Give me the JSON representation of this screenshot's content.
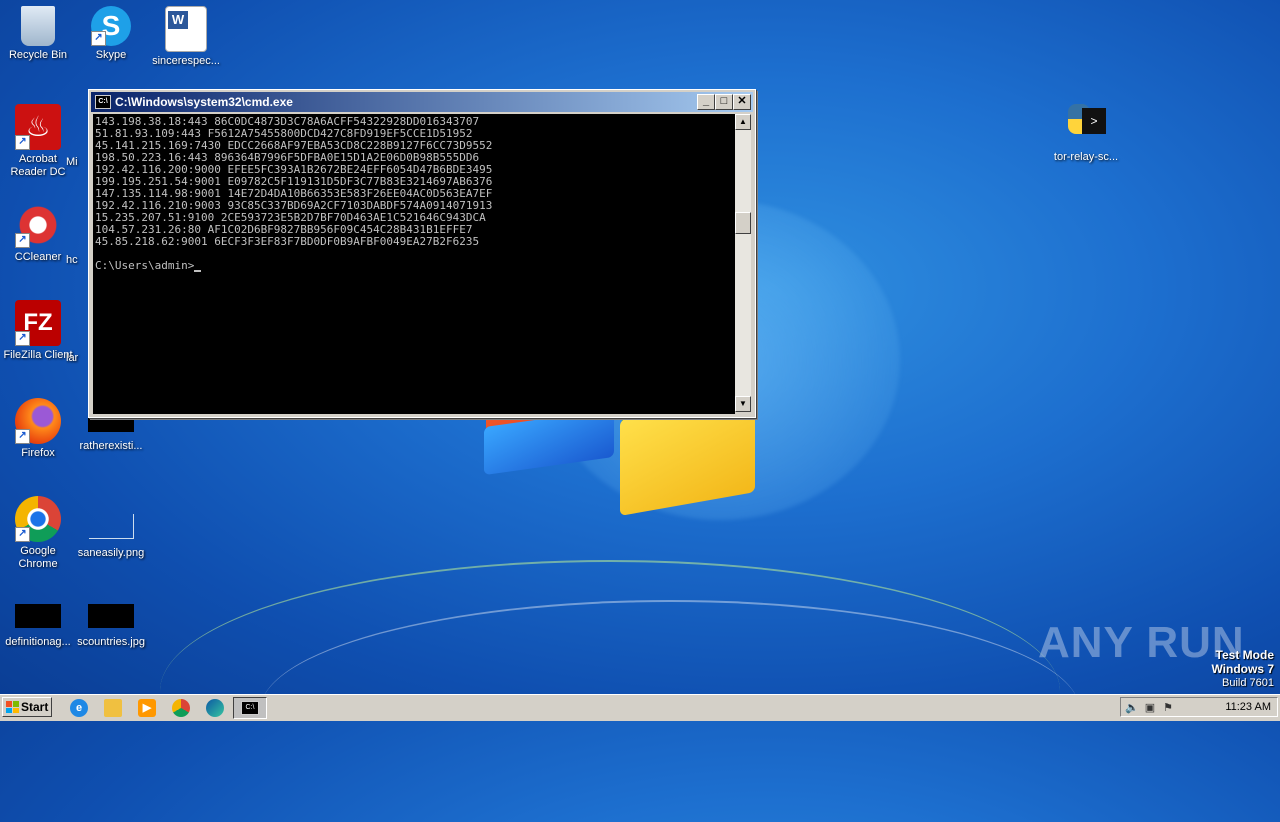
{
  "desktop": {
    "icons": [
      {
        "label": "Recycle Bin",
        "icon": "recycle-bin-icon"
      },
      {
        "label": "Skype",
        "icon": "skype-icon"
      },
      {
        "label": "sincerespec...",
        "icon": "word-document-icon"
      },
      {
        "label": "Acrobat Reader DC",
        "icon": "acrobat-icon"
      },
      {
        "label": "Mi",
        "icon": "partial-icon"
      },
      {
        "label": "CCleaner",
        "icon": "ccleaner-icon"
      },
      {
        "label": "hc",
        "icon": "partial-icon"
      },
      {
        "label": "FileZilla Client",
        "icon": "filezilla-icon"
      },
      {
        "label": "lar",
        "icon": "partial-icon"
      },
      {
        "label": "Firefox",
        "icon": "firefox-icon"
      },
      {
        "label": "ratherexisti...",
        "icon": "black-file-icon"
      },
      {
        "label": "Google Chrome",
        "icon": "chrome-icon"
      },
      {
        "label": "saneasily.png",
        "icon": "png-file-icon"
      },
      {
        "label": "definitionag...",
        "icon": "black-file-icon"
      },
      {
        "label": "scountries.jpg",
        "icon": "black-file-icon"
      },
      {
        "label": "tor-relay-sc...",
        "icon": "python-script-icon"
      }
    ]
  },
  "cmd_window": {
    "title": "C:\\Windows\\system32\\cmd.exe",
    "minimize": "_",
    "maximize": "□",
    "close": "✕",
    "lines": [
      "143.198.38.18:443 86C0DC4873D3C78A6ACFF54322928DD016343707",
      "51.81.93.109:443 F5612A75455800DCD427C8FD919EF5CCE1D51952",
      "45.141.215.169:7430 EDCC2668AF97EBA53CD8C228B9127F6CC73D9552",
      "198.50.223.16:443 896364B7996F5DFBA0E15D1A2E06D0B98B555DD6",
      "192.42.116.200:9000 EFEE5FC393A1B2672BE24EFF6054D47B6BDE3495",
      "199.195.251.54:9001 E09782C5F119131D5DF3C77B83E3214697AB6376",
      "147.135.114.98:9001 14E72D4DA10B66353E583F26EE04AC0D563EA7EF",
      "192.42.116.210:9003 93C85C337BD69A2CF7103DABDF574A0914071913",
      "15.235.207.51:9100 2CE593723E5B2D7BF70D463AE1C521646C943DCA",
      "104.57.231.26:80 AF1C02D6BF9827BB956F09C454C28B431B1EFFE7",
      "45.85.218.62:9001 6ECF3F3EF83F7BD0DF0B9AFBF0049EA27B2F6235",
      "",
      "C:\\Users\\admin>"
    ]
  },
  "watermark": {
    "brand": "ANY RUN",
    "mode": "Test Mode",
    "os": "Windows 7",
    "build": "Build 7601"
  },
  "taskbar": {
    "start_label": "Start",
    "clock": "11:23 AM",
    "quick_launch": [
      "internet-explorer-icon",
      "folder-icon",
      "media-player-icon",
      "chrome-icon",
      "edge-icon"
    ],
    "active_task_icon": "cmd-icon"
  },
  "colors": {
    "titlebar_start": "#0a246a",
    "titlebar_end": "#a6caf0",
    "console_bg": "#000000",
    "console_fg": "#c0c0c0"
  }
}
